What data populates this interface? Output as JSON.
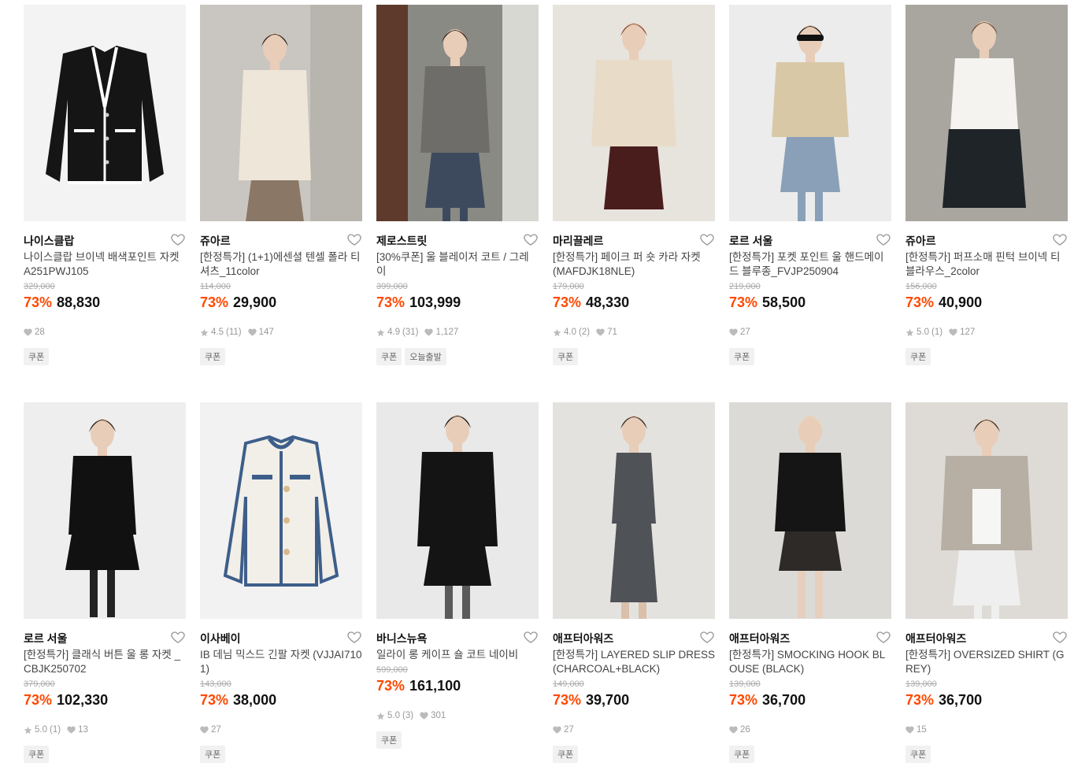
{
  "products": [
    {
      "brand": "나이스클랍",
      "title": "나이스클랍 브이넥 배색포인트 자켓 A251PWJ105",
      "original_price": "329,000",
      "discount": "73%",
      "price": "88,830",
      "rating": "",
      "reviews": "",
      "likes": "28",
      "tags": [
        "쿠폰"
      ],
      "image": "tweed-jacket-black",
      "bg": "#f3f3f3"
    },
    {
      "brand": "쥬아르",
      "title": "[한정특가] (1+1)에센셜 텐셀 폴라 티셔츠_11color",
      "original_price": "114,000",
      "discount": "73%",
      "price": "29,900",
      "rating": "4.5",
      "reviews": "(11)",
      "likes": "147",
      "tags": [
        "쿠폰"
      ],
      "image": "model-ivory-turtleneck",
      "bg": "#c9c6c1"
    },
    {
      "brand": "제로스트릿",
      "title": "[30%쿠폰] 울 블레이저 코트 / 그레이",
      "original_price": "399,000",
      "discount": "73%",
      "price": "103,999",
      "rating": "4.9",
      "reviews": "(31)",
      "likes": "1,127",
      "tags": [
        "쿠폰",
        "오늘출발"
      ],
      "image": "model-grey-blazer",
      "bg": "#8a8a84"
    },
    {
      "brand": "마리끌레르",
      "title": "[한정특가] 페이크 퍼 숏 카라 자켓 (MAFDJK18NLE)",
      "original_price": "179,000",
      "discount": "73%",
      "price": "48,330",
      "rating": "4.0",
      "reviews": "(2)",
      "likes": "71",
      "tags": [
        "쿠폰"
      ],
      "image": "model-fur-jacket",
      "bg": "#e7e4de"
    },
    {
      "brand": "로르 서울",
      "title": "[한정특가] 포켓 포인트 울 핸드메이드 블루종_FVJP250904",
      "original_price": "219,000",
      "discount": "73%",
      "price": "58,500",
      "rating": "",
      "reviews": "",
      "likes": "27",
      "tags": [
        "쿠폰"
      ],
      "image": "model-beige-blouson",
      "bg": "#ececec"
    },
    {
      "brand": "쥬아르",
      "title": "[한정특가] 퍼프소매 핀턱 브이넥 티블라우스_2color",
      "original_price": "156,000",
      "discount": "73%",
      "price": "40,900",
      "rating": "5.0",
      "reviews": "(1)",
      "likes": "127",
      "tags": [
        "쿠폰"
      ],
      "image": "model-white-blouse",
      "bg": "#a9a6a0"
    },
    {
      "brand": "로르 서울",
      "title": "[한정특가] 클래식 버튼 울 롱 자켓 _CBJK250702",
      "original_price": "379,000",
      "discount": "73%",
      "price": "102,330",
      "rating": "5.0",
      "reviews": "(1)",
      "likes": "13",
      "tags": [
        "쿠폰"
      ],
      "image": "model-black-long-jacket",
      "bg": "#eeeeee"
    },
    {
      "brand": "이사베이",
      "title": "IB 데님 믹스드 긴팔 자켓 (VJJAI7101)",
      "original_price": "143,000",
      "discount": "73%",
      "price": "38,000",
      "rating": "",
      "reviews": "",
      "likes": "27",
      "tags": [
        "쿠폰"
      ],
      "image": "tweed-jacket-ivory-denim",
      "bg": "#f2f2f2"
    },
    {
      "brand": "바니스뉴욕",
      "title": "일라이 롱 케이프 숄 코트 네이비",
      "original_price": "599,000",
      "discount": "73%",
      "price": "161,100",
      "rating": "5.0",
      "reviews": "(3)",
      "likes": "301",
      "tags": [
        "쿠폰"
      ],
      "image": "model-cape-coat",
      "bg": "#e9e9e9"
    },
    {
      "brand": "애프터아워즈",
      "title": "[한정특가] LAYERED SLIP DRESS (CHARCOAL+BLACK)",
      "original_price": "149,000",
      "discount": "73%",
      "price": "39,700",
      "rating": "",
      "reviews": "",
      "likes": "27",
      "tags": [
        "쿠폰"
      ],
      "image": "model-slip-dress",
      "bg": "#e4e2de"
    },
    {
      "brand": "애프터아워즈",
      "title": "[한정특가] SMOCKING HOOK BLOUSE (BLACK)",
      "original_price": "139,000",
      "discount": "73%",
      "price": "36,700",
      "rating": "",
      "reviews": "",
      "likes": "26",
      "tags": [
        "쿠폰"
      ],
      "image": "model-smocking-blouse",
      "bg": "#dcdad6"
    },
    {
      "brand": "애프터아워즈",
      "title": "[한정특가] OVERSIZED SHIRT (GREY)",
      "original_price": "139,000",
      "discount": "73%",
      "price": "36,700",
      "rating": "",
      "reviews": "",
      "likes": "15",
      "tags": [
        "쿠폰"
      ],
      "image": "model-oversized-shirt",
      "bg": "#dedbd6"
    }
  ],
  "colors": {
    "discount": "#ff4800",
    "tag_bg": "#f1f1f1",
    "muted": "#999999"
  }
}
